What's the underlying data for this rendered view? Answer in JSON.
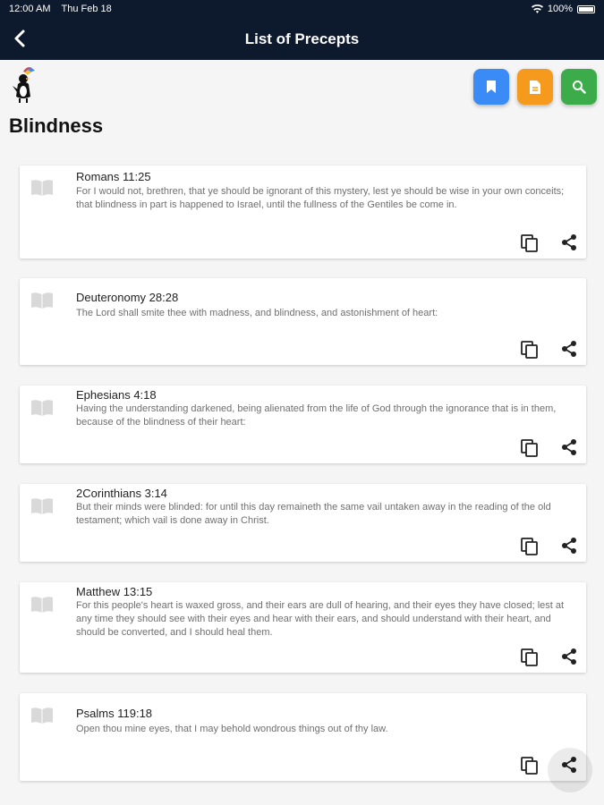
{
  "status": {
    "time": "12:00 AM",
    "date": "Thu Feb 18",
    "battery": "100%"
  },
  "header": {
    "title": "List of Precepts"
  },
  "page": {
    "heading": "Blindness"
  },
  "toolbar": {
    "icons": [
      "bookmark-icon",
      "document-icon",
      "search-icon"
    ],
    "colors": [
      "#3a8bf5",
      "#f59a1d",
      "#3cab4a"
    ]
  },
  "precepts": [
    {
      "ref": "Romans 11:25",
      "text": "For I would not, brethren, that ye should be ignorant of this mystery, lest ye should be wise in your own conceits; that blindness in part is happened to Israel, until the fullness of the Gentiles be come in."
    },
    {
      "ref": "Deuteronomy 28:28",
      "text": "The Lord shall smite thee with madness, and blindness, and astonishment of heart:"
    },
    {
      "ref": "Ephesians 4:18",
      "text": "Having the understanding darkened, being alienated from the life of God through the ignorance that is in them, because of the blindness of their heart:"
    },
    {
      "ref": "2Corinthians 3:14",
      "text": "But their minds were blinded: for until this day remaineth the same vail untaken away in the reading of the old testament; which vail is done away in Christ."
    },
    {
      "ref": "Matthew 13:15",
      "text": "For this people's heart is waxed gross, and their ears are dull of hearing, and their eyes they have closed; lest at any time they should see with their eyes and hear with their ears, and should understand with their heart, and should be converted, and I should heal them."
    },
    {
      "ref": "Psalms 119:18",
      "text": "Open thou mine eyes, that I may behold wondrous things out of thy law."
    }
  ]
}
